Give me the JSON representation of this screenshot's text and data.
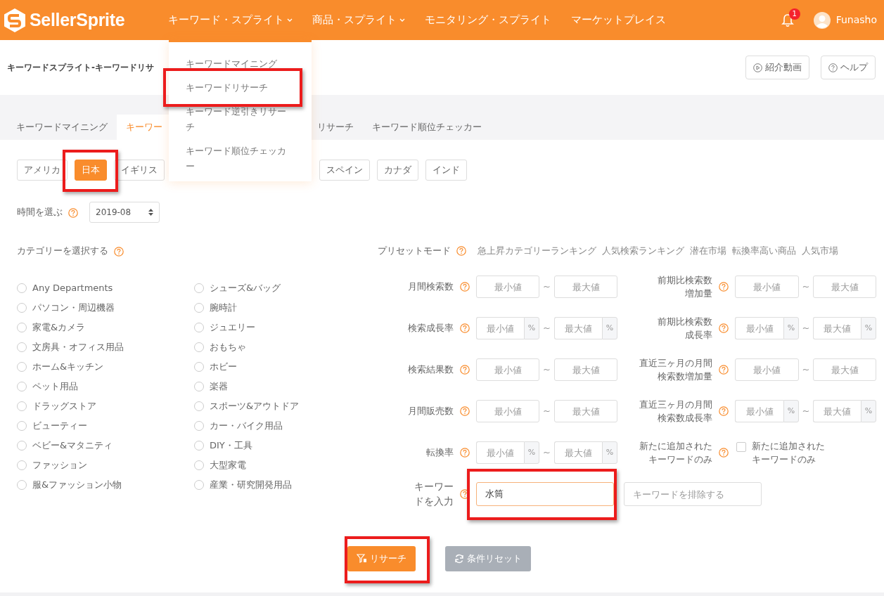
{
  "brand": "SellerSprite",
  "nav": [
    {
      "label": "キーワード・スプライト",
      "caret": true
    },
    {
      "label": "商品・スプライト",
      "caret": true
    },
    {
      "label": "モニタリング・スプライト",
      "caret": false
    },
    {
      "label": "マーケットプレイス",
      "caret": false
    }
  ],
  "notifications": {
    "count": "1"
  },
  "user": {
    "name": "Funasho"
  },
  "dropdown": [
    "キーワードマイニング",
    "キーワードリサーチ",
    "キーワード逆引きリサーチ",
    "キーワード順位チェッカー"
  ],
  "page_title": "キーワードスプライト-キーワードリサ",
  "header_buttons": [
    {
      "label": "紹介動画",
      "kind": "video"
    },
    {
      "label": "ヘルプ",
      "kind": "help"
    }
  ],
  "tabs": [
    {
      "label": "キーワードマイニング",
      "selected": false
    },
    {
      "label": "キーワー",
      "selected": true
    },
    {
      "label": "リサーチ",
      "selected": false
    },
    {
      "label": "キーワード順位チェッカー",
      "selected": false
    }
  ],
  "countries": [
    [
      {
        "label": "アメリカ",
        "selected": false
      },
      {
        "label": "日本",
        "selected": true
      },
      {
        "label": "イギリス",
        "selected": false
      }
    ],
    [
      {
        "label": "スペイン",
        "selected": false
      },
      {
        "label": "カナダ",
        "selected": false
      },
      {
        "label": "インド",
        "selected": false
      }
    ]
  ],
  "time": {
    "label": "時間を選ぶ",
    "value": "2019-08"
  },
  "categories": {
    "label": "カテゴリーを選択する",
    "items": [
      {
        "label": "Any Departments",
        "selected": false
      },
      {
        "label": "パソコン・周辺機器",
        "selected": false
      },
      {
        "label": "家電&カメラ",
        "selected": false
      },
      {
        "label": "文房具・オフィス用品",
        "selected": false
      },
      {
        "label": "ホーム&キッチン",
        "selected": false
      },
      {
        "label": "ペット用品",
        "selected": false
      },
      {
        "label": "ドラッグストア",
        "selected": false
      },
      {
        "label": "ビューティー",
        "selected": false
      },
      {
        "label": "ベビー&マタニティ",
        "selected": false
      },
      {
        "label": "ファッション",
        "selected": false
      },
      {
        "label": "服&ファッション小物",
        "selected": false
      },
      {
        "label": "シューズ&バッグ",
        "selected": false
      },
      {
        "label": "腕時計",
        "selected": false
      },
      {
        "label": "ジュエリー",
        "selected": false
      },
      {
        "label": "おもちゃ",
        "selected": false
      },
      {
        "label": "ホビー",
        "selected": false
      },
      {
        "label": "楽器",
        "selected": false
      },
      {
        "label": "スポーツ&アウトドア",
        "selected": false
      },
      {
        "label": "カー・バイク用品",
        "selected": false
      },
      {
        "label": "DIY・工具",
        "selected": false
      },
      {
        "label": "大型家電",
        "selected": false
      },
      {
        "label": "産業・研究開発用品",
        "selected": false
      }
    ]
  },
  "preset": {
    "label": "プリセットモード",
    "options": [
      "急上昇カテゴリーランキング",
      "人気検索ランキング",
      "潜在市場",
      "転換率高い商品",
      "人気市場"
    ]
  },
  "filters": [
    {
      "kind": "range",
      "label": [
        "月間検索数"
      ],
      "min_placeholder": "最小値",
      "separator": "~",
      "max_placeholder": "最大値"
    },
    {
      "kind": "range",
      "label": [
        "前期比検索数",
        "増加量"
      ],
      "min_placeholder": "最小値",
      "separator": "~",
      "max_placeholder": "最大値"
    },
    {
      "kind": "range",
      "label": [
        "検索成長率"
      ],
      "min_placeholder": "最小値",
      "unit": "%",
      "separator": "~",
      "max_placeholder": "最大値",
      "max_unit": "%"
    },
    {
      "kind": "range",
      "label": [
        "前期比検索数",
        "成長率"
      ],
      "min_placeholder": "最小値",
      "unit": "%",
      "separator": "~",
      "max_placeholder": "最大値",
      "max_unit": "%"
    },
    {
      "kind": "range",
      "label": [
        "検索結果数"
      ],
      "min_placeholder": "最小値",
      "separator": "~",
      "max_placeholder": "最大値"
    },
    {
      "kind": "range",
      "label": [
        "直近三ヶ月の月間",
        "検索数増加量"
      ],
      "min_placeholder": "最小値",
      "separator": "~",
      "max_placeholder": "最大値"
    },
    {
      "kind": "range",
      "label": [
        "月間販売数"
      ],
      "min_placeholder": "最小値",
      "separator": "~",
      "max_placeholder": "最大値"
    },
    {
      "kind": "range",
      "label": [
        "直近三ヶ月の月間",
        "検索数成長率"
      ],
      "min_placeholder": "最小値",
      "unit": "%",
      "separator": "~",
      "max_placeholder": "最大値",
      "max_unit": "%"
    },
    {
      "kind": "range",
      "label": [
        "転換率"
      ],
      "min_placeholder": "最小値",
      "unit": "%",
      "separator": "~",
      "max_placeholder": "最大値",
      "max_unit": "%"
    },
    {
      "kind": "checkbox",
      "label": [
        "新たに追加された",
        "キーワードのみ"
      ],
      "option": [
        "新たに追加された",
        "キーワードのみ"
      ],
      "checked": false
    }
  ],
  "keyword": {
    "label": [
      "キーワー",
      "ドを入力"
    ],
    "value": "水筒",
    "exclude_placeholder": "キーワードを排除する"
  },
  "actions": [
    {
      "label": "リサーチ",
      "kind": "search",
      "disabled": false
    },
    {
      "label": "条件リセット",
      "kind": "reset",
      "disabled": true
    }
  ]
}
